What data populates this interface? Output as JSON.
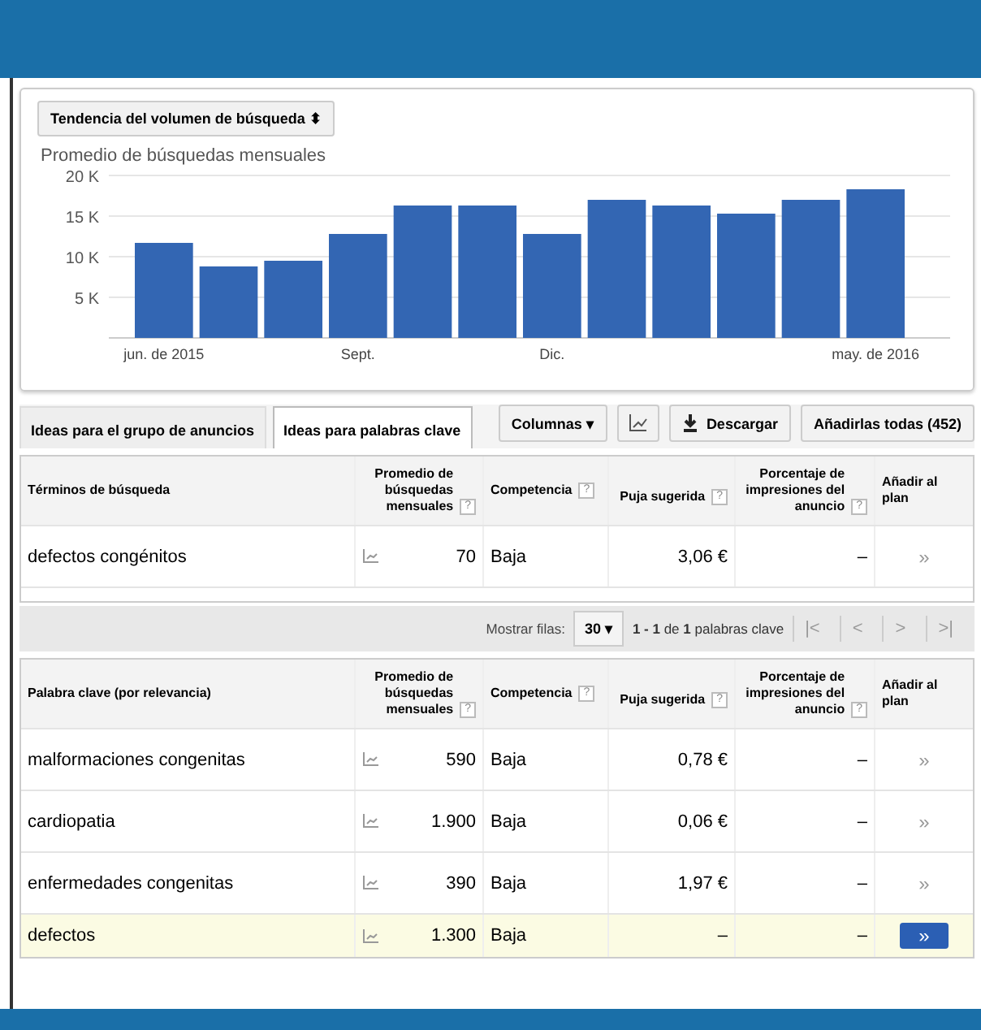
{
  "trend_selector": {
    "label": "Tendencia del volumen de búsqueda",
    "icon": "⬍"
  },
  "chart": {
    "chart_data": {
      "type": "bar",
      "title": "Promedio de búsquedas mensuales",
      "categories": [
        "jun. de 2015",
        null,
        null,
        "Sept.",
        null,
        null,
        "Dic.",
        null,
        null,
        null,
        null,
        "may. de 2016"
      ],
      "values": [
        11700,
        8800,
        9500,
        12800,
        16300,
        16300,
        12800,
        17000,
        16300,
        15300,
        17000,
        18300
      ],
      "ylim": [
        0,
        20000
      ],
      "grid": true,
      "yticks": [
        {
          "value": 5000,
          "label": "5 K"
        },
        {
          "value": 10000,
          "label": "10 K"
        },
        {
          "value": 15000,
          "label": "15 K"
        },
        {
          "value": 20000,
          "label": "20 K"
        }
      ]
    }
  },
  "tabs": [
    {
      "label": "Ideas para el grupo de anuncios",
      "selected": false
    },
    {
      "label": "Ideas para palabras clave",
      "selected": true
    }
  ],
  "toolbar": {
    "columns": "Columnas",
    "columns_caret": "▾",
    "download": "Descargar",
    "add_all": "Añadirlas todas (452)"
  },
  "search_table": {
    "columns": [
      {
        "label": "Términos de búsqueda"
      },
      {
        "label": "Promedio de búsquedas mensuales",
        "help": "?"
      },
      {
        "label": "Competencia",
        "help": "?"
      },
      {
        "label": "Puja sugerida",
        "help": "?"
      },
      {
        "label": "Porcentaje de impresiones del anuncio",
        "help": "?"
      },
      {
        "label": "Añadir al plan"
      }
    ],
    "rows": [
      {
        "term": "defectos congénitos",
        "searches": "70",
        "competition": "Baja",
        "bid": "3,06 €",
        "share": "–",
        "add": "»",
        "selected": false
      }
    ]
  },
  "pagination": {
    "label": "Mostrar filas:",
    "rows": "30",
    "caret": "▾",
    "range": "**1 - 1** de **1** palabras clave",
    "first": "|<",
    "prev": "<",
    "next": ">",
    "last": ">|"
  },
  "keyword_table": {
    "columns": [
      {
        "label": "Palabra clave (por relevancia)"
      },
      {
        "label": "Promedio de búsquedas mensuales",
        "help": "?"
      },
      {
        "label": "Competencia",
        "help": "?"
      },
      {
        "label": "Puja sugerida",
        "help": "?"
      },
      {
        "label": "Porcentaje de impresiones del anuncio",
        "help": "?"
      },
      {
        "label": "Añadir al plan"
      }
    ],
    "rows": [
      {
        "term": "malformaciones congenitas",
        "searches": "590",
        "competition": "Baja",
        "bid": "0,78 €",
        "share": "–",
        "add": "»",
        "selected": false
      },
      {
        "term": "cardiopatia",
        "searches": "1.900",
        "competition": "Baja",
        "bid": "0,06 €",
        "share": "–",
        "add": "»",
        "selected": false
      },
      {
        "term": "enfermedades congenitas",
        "searches": "390",
        "competition": "Baja",
        "bid": "1,97 €",
        "share": "–",
        "add": "»",
        "selected": false
      },
      {
        "term": "defectos",
        "searches": "1.300",
        "competition": "Baja",
        "bid": "–",
        "share": "–",
        "add": "»",
        "selected": true
      }
    ]
  }
}
